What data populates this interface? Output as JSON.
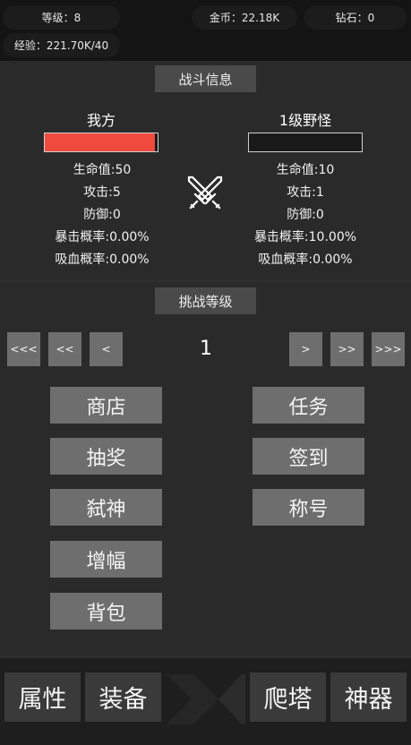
{
  "topbar": {
    "level_label": "等级：8",
    "gold_label": "金币：22.18K",
    "diamond_label": "钻石：0",
    "exp_label": "经验：221.70K/40"
  },
  "battle": {
    "title": "战斗信息",
    "player": {
      "name": "我方",
      "hp_fraction": 0.98,
      "hp_color": "#f04a3e",
      "hp": "生命值:50",
      "attack": "攻击:5",
      "defense": "防御:0",
      "crit": "暴击概率:0.00%",
      "lifesteal": "吸血概率:0.00%"
    },
    "enemy": {
      "name": "1级野怪",
      "hp_fraction": 0.0,
      "hp": "生命值:10",
      "attack": "攻击:1",
      "defense": "防御:0",
      "crit": "暴击概率:10.00%",
      "lifesteal": "吸血概率:0.00%"
    },
    "vs_icon": "crossed-swords-icon"
  },
  "challenge": {
    "title": "挑战等级",
    "first_label": "<<<",
    "prev10_label": "<<",
    "prev_label": "<",
    "level": "1",
    "next_label": ">",
    "next10_label": ">>",
    "last_label": ">>>"
  },
  "menu": {
    "shop": "商店",
    "quest": "任务",
    "lottery": "抽奖",
    "checkin": "签到",
    "slay_god": "弑神",
    "title": "称号",
    "amplify": "增幅",
    "backpack": "背包"
  },
  "tabs": {
    "attributes": "属性",
    "equipment": "装备",
    "tower": "爬塔",
    "artifact": "神器"
  }
}
